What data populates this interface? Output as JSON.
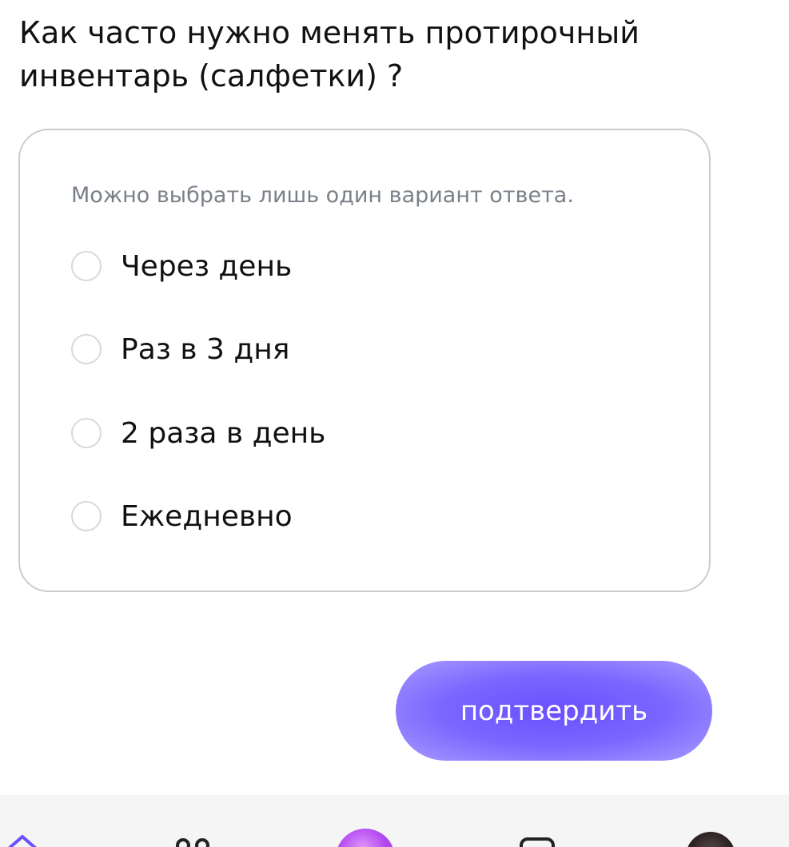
{
  "question": {
    "line1": "Как часто нужно менять протирочный",
    "line2": "инвентарь (салфетки) ?"
  },
  "hint": "Можно выбрать лишь один вариант ответа.",
  "options": [
    {
      "label": "Через день",
      "selected": false
    },
    {
      "label": "Раз в 3 дня",
      "selected": false
    },
    {
      "label": "2 раза в день",
      "selected": false
    },
    {
      "label": "Ежедневно",
      "selected": false
    }
  ],
  "confirm_label": "подтвердить",
  "colors": {
    "accent": "#6a50ff",
    "card_border": "#c9cdd2",
    "hint_text": "#7a8088",
    "nav_background": "#f5f5f6"
  },
  "bottom_nav": [
    {
      "icon": "home-icon"
    },
    {
      "icon": "catalog-icon"
    },
    {
      "icon": "assistant-orb-icon"
    },
    {
      "icon": "chat-icon"
    },
    {
      "icon": "profile-avatar"
    }
  ]
}
